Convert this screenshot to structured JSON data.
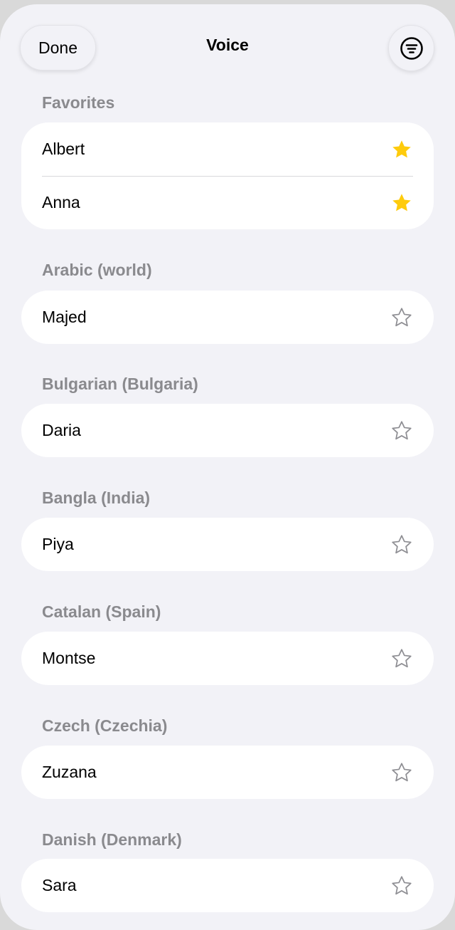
{
  "header": {
    "done_label": "Done",
    "title": "Voice",
    "filter_icon": "filter-circle-icon"
  },
  "colors": {
    "background": "#f2f2f7",
    "section_header": "#8a8a8e",
    "star_filled": "#fecb0c",
    "star_outline": "#8e8e93"
  },
  "sections": [
    {
      "title": "Favorites",
      "items": [
        {
          "label": "Albert",
          "favorite": true
        },
        {
          "label": "Anna",
          "favorite": true
        }
      ]
    },
    {
      "title": "Arabic (world)",
      "items": [
        {
          "label": "Majed",
          "favorite": false
        }
      ]
    },
    {
      "title": "Bulgarian (Bulgaria)",
      "items": [
        {
          "label": "Daria",
          "favorite": false
        }
      ]
    },
    {
      "title": "Bangla (India)",
      "items": [
        {
          "label": "Piya",
          "favorite": false
        }
      ]
    },
    {
      "title": "Catalan (Spain)",
      "items": [
        {
          "label": "Montse",
          "favorite": false
        }
      ]
    },
    {
      "title": "Czech (Czechia)",
      "items": [
        {
          "label": "Zuzana",
          "favorite": false
        }
      ]
    },
    {
      "title": "Danish (Denmark)",
      "items": [
        {
          "label": "Sara",
          "favorite": false
        }
      ]
    }
  ]
}
